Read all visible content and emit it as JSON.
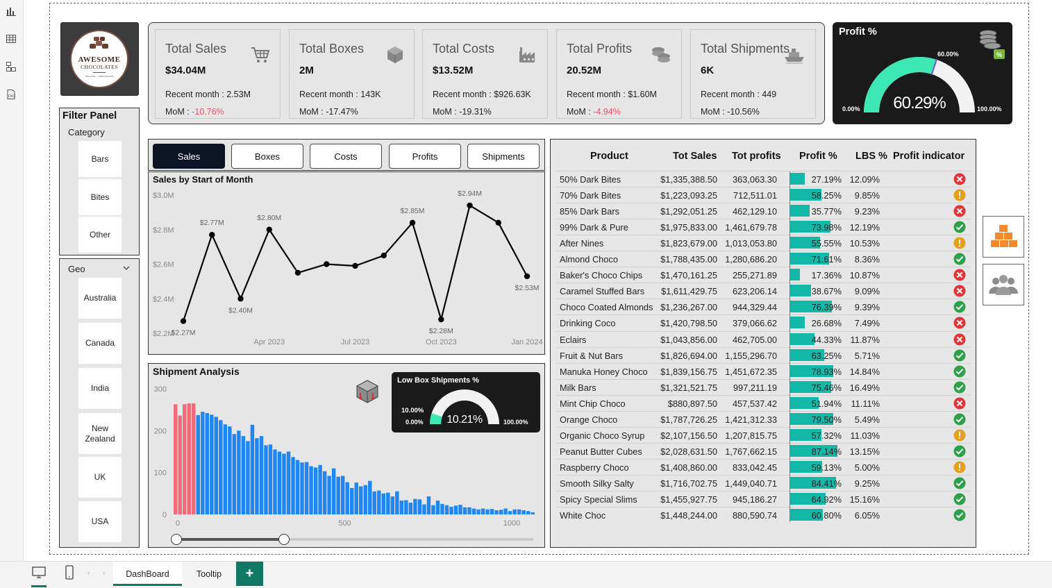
{
  "kpis": [
    {
      "title": "Total Sales",
      "value": "$34.04M",
      "recent": "Recent month : 2.53M",
      "mom_label": "MoM :",
      "mom": "-10.76%",
      "mom_color": "#e8546a",
      "icon": "cart-icon"
    },
    {
      "title": "Total Boxes",
      "value": "2M",
      "recent": "Recent month : 143K",
      "mom_label": "MoM :",
      "mom": "-17.47%",
      "mom_color": "#222222",
      "icon": "box-icon"
    },
    {
      "title": "Total Costs",
      "value": "$13.52M",
      "recent": "Recent month : $926.63K",
      "mom_label": "MoM :",
      "mom": "-19.31%",
      "mom_color": "#222222",
      "icon": "factory-icon"
    },
    {
      "title": "Total Profits",
      "value": "20.52M",
      "recent": "Recent month : $1.60M",
      "mom_label": "MoM :",
      "mom": "-4.94%",
      "mom_color": "#e8546a",
      "icon": "coins-icon"
    },
    {
      "title": "Total Shipments",
      "value": "6K",
      "recent": "Recent month : 449",
      "mom_label": "MoM :",
      "mom": "-10.56%",
      "mom_color": "#222222",
      "icon": "ship-icon"
    }
  ],
  "logo": {
    "line1": "AWESOME",
    "line2": "CHOCOLATES",
    "line3": "ORGANIC · WHOLESOME"
  },
  "profit_gauge": {
    "title": "Profit %",
    "value": "60.29%",
    "target": "60.00%",
    "min": "0.00%",
    "max": "100.00%",
    "fraction": 0.6029,
    "target_fraction": 0.6,
    "badge": "%",
    "color": "#3de8b4"
  },
  "filter": {
    "title": "Filter Panel",
    "category_label": "Category",
    "categories": [
      "Bars",
      "Bites",
      "Other"
    ],
    "geo_label": "Geo",
    "geos": [
      "Australia",
      "Canada",
      "India",
      "New Zealand",
      "UK",
      "USA"
    ]
  },
  "tabs": [
    "Sales",
    "Boxes",
    "Costs",
    "Profits",
    "Shipments"
  ],
  "sales_chart": {
    "title": "Sales by Start of Month"
  },
  "shipment": {
    "title": "Shipment Analysis",
    "gauge_title": "Low Box Shipments %",
    "gauge_value": "10.21%",
    "gauge_target": "10.00%",
    "gauge_min": "0.00%",
    "gauge_max": "100.00%",
    "gauge_fraction": 0.1021
  },
  "table": {
    "headers": [
      "Product",
      "Tot Sales",
      "Tot profits",
      "Profit %",
      "LBS %",
      "Profit indicator"
    ],
    "rows": [
      [
        "50% Dark Bites",
        "$1,335,388.50",
        "363,063.30",
        "27.19%",
        "12.09%",
        "bad"
      ],
      [
        "70% Dark Bites",
        "$1,223,093.25",
        "712,511.01",
        "58.25%",
        "9.85%",
        "warn"
      ],
      [
        "85% Dark Bars",
        "$1,292,051.25",
        "462,129.10",
        "35.77%",
        "9.23%",
        "bad"
      ],
      [
        "99% Dark & Pure",
        "$1,975,833.00",
        "1,461,679.78",
        "73.98%",
        "12.19%",
        "good"
      ],
      [
        "After Nines",
        "$1,823,679.00",
        "1,013,053.80",
        "55.55%",
        "10.53%",
        "warn"
      ],
      [
        "Almond Choco",
        "$1,788,435.00",
        "1,280,686.20",
        "71.61%",
        "8.36%",
        "good"
      ],
      [
        "Baker's Choco Chips",
        "$1,470,161.25",
        "255,271.89",
        "17.36%",
        "10.87%",
        "bad"
      ],
      [
        "Caramel Stuffed Bars",
        "$1,611,429.75",
        "623,206.14",
        "38.67%",
        "9.09%",
        "bad"
      ],
      [
        "Choco Coated Almonds",
        "$1,236,267.00",
        "944,329.44",
        "76.39%",
        "9.39%",
        "good"
      ],
      [
        "Drinking Coco",
        "$1,420,798.50",
        "379,066.62",
        "26.68%",
        "7.49%",
        "bad"
      ],
      [
        "Eclairs",
        "$1,043,856.00",
        "462,705.00",
        "44.33%",
        "11.87%",
        "bad"
      ],
      [
        "Fruit & Nut Bars",
        "$1,826,694.00",
        "1,155,296.70",
        "63.25%",
        "5.71%",
        "good"
      ],
      [
        "Manuka Honey Choco",
        "$1,839,156.75",
        "1,451,672.35",
        "78.93%",
        "14.84%",
        "good"
      ],
      [
        "Milk Bars",
        "$1,321,521.75",
        "997,211.19",
        "75.46%",
        "16.49%",
        "good"
      ],
      [
        "Mint Chip Choco",
        "$880,897.50",
        "457,537.42",
        "51.94%",
        "11.11%",
        "bad"
      ],
      [
        "Orange Choco",
        "$1,787,726.25",
        "1,421,312.33",
        "79.50%",
        "5.49%",
        "good"
      ],
      [
        "Organic Choco Syrup",
        "$2,107,156.50",
        "1,207,815.75",
        "57.32%",
        "11.03%",
        "warn"
      ],
      [
        "Peanut Butter Cubes",
        "$2,028,631.50",
        "1,767,662.15",
        "87.14%",
        "13.15%",
        "good"
      ],
      [
        "Raspberry Choco",
        "$1,408,860.00",
        "833,042.45",
        "59.13%",
        "5.00%",
        "warn"
      ],
      [
        "Smooth Silky Salty",
        "$1,716,702.75",
        "1,449,040.71",
        "84.41%",
        "9.25%",
        "good"
      ],
      [
        "Spicy Special Slims",
        "$1,455,927.75",
        "945,186.27",
        "64.92%",
        "15.16%",
        "good"
      ],
      [
        "White Choc",
        "$1,448,244.00",
        "880,590.74",
        "60.80%",
        "6.05%",
        "good"
      ]
    ],
    "indicator_colors": {
      "good": "#2ea04a",
      "warn": "#e5a11a",
      "bad": "#e0353b"
    },
    "bar_color": "#13b8a8"
  },
  "bottom_tabs": [
    "DashBoard",
    "Tooltip"
  ],
  "add_tab_label": "+",
  "chart_data": [
    {
      "type": "line",
      "title": "Sales by Start of Month",
      "x": [
        "2023-01",
        "2023-02",
        "2023-03",
        "2023-04",
        "2023-05",
        "2023-06",
        "2023-07",
        "2023-08",
        "2023-09",
        "2023-10",
        "2023-11",
        "2023-12",
        "2024-01",
        "2024-02"
      ],
      "values": [
        2.27,
        2.77,
        2.4,
        2.8,
        2.55,
        2.6,
        2.59,
        2.65,
        2.84,
        2.28,
        2.94,
        2.84,
        2.53
      ],
      "point_labels": {
        "0": "$2.27M",
        "1": "$2.77M",
        "2": "$2.40M",
        "3": "$2.80M",
        "8": "$2.85M",
        "9": "$2.28M",
        "10": "$2.94M",
        "12": "$2.53M"
      },
      "x_tick_labels": [
        "Apr 2023",
        "Jul 2023",
        "Oct 2023",
        "Jan 2024"
      ],
      "y_tick_labels": [
        "$3.0M",
        "$2.8M",
        "$2.6M",
        "$2.4M",
        "$2.2M"
      ],
      "ylim": [
        2.2,
        3.0
      ]
    },
    {
      "type": "bar",
      "title": "Shipment Analysis",
      "x_range": [
        0,
        1000
      ],
      "x_tick_labels": [
        "0",
        "500",
        "1000"
      ],
      "y_tick_labels": [
        "300",
        "200",
        "100",
        "0"
      ],
      "ylim": [
        0,
        300
      ],
      "values": [
        263,
        236,
        263,
        265,
        265,
        237,
        245,
        242,
        238,
        233,
        225,
        215,
        210,
        192,
        200,
        187,
        175,
        214,
        182,
        187,
        165,
        167,
        155,
        150,
        145,
        150,
        137,
        130,
        124,
        125,
        115,
        112,
        118,
        103,
        92,
        110,
        90,
        92,
        77,
        63,
        76,
        67,
        70,
        80,
        55,
        57,
        50,
        52,
        43,
        55,
        33,
        34,
        28,
        37,
        36,
        24,
        43,
        22,
        33,
        25,
        22,
        18,
        21,
        23,
        17,
        17,
        14,
        12,
        14,
        12,
        13,
        10,
        11,
        14,
        8,
        12,
        12,
        10,
        8,
        5
      ],
      "highlight_count": 5,
      "highlight_color": "#f06b78",
      "bar_color": "#1f86f2"
    }
  ]
}
